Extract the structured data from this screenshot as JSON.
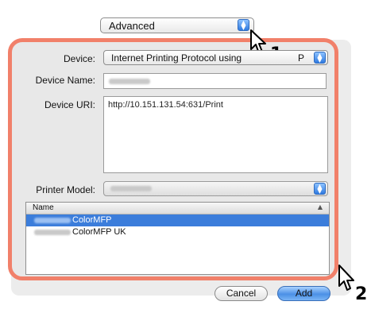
{
  "top_popup": {
    "value": "Advanced"
  },
  "form": {
    "device_label": "Device:",
    "device_value": "Internet Printing Protocol using",
    "device_value_tail": "P",
    "device_name_label": "Device Name:",
    "device_uri_label": "Device URI:",
    "device_uri_value": "http://10.151.131.54:631/Print",
    "printer_model_label": "Printer Model:"
  },
  "model_list": {
    "column_header": "Name",
    "sort_indicator": "▲",
    "rows": [
      {
        "label": "ColorMFP",
        "selected": true
      },
      {
        "label": "ColorMFP UK",
        "selected": false
      }
    ]
  },
  "buttons": {
    "cancel": "Cancel",
    "add": "Add"
  },
  "callouts": {
    "step1": "1",
    "step2": "2"
  },
  "colors": {
    "highlight": "#f1806a",
    "selection": "#3b7ddb",
    "accent_blue": "#4b90e6"
  },
  "icons": {
    "popup_arrows": "updown-arrows-icon",
    "cursor": "arrow-cursor-icon"
  }
}
